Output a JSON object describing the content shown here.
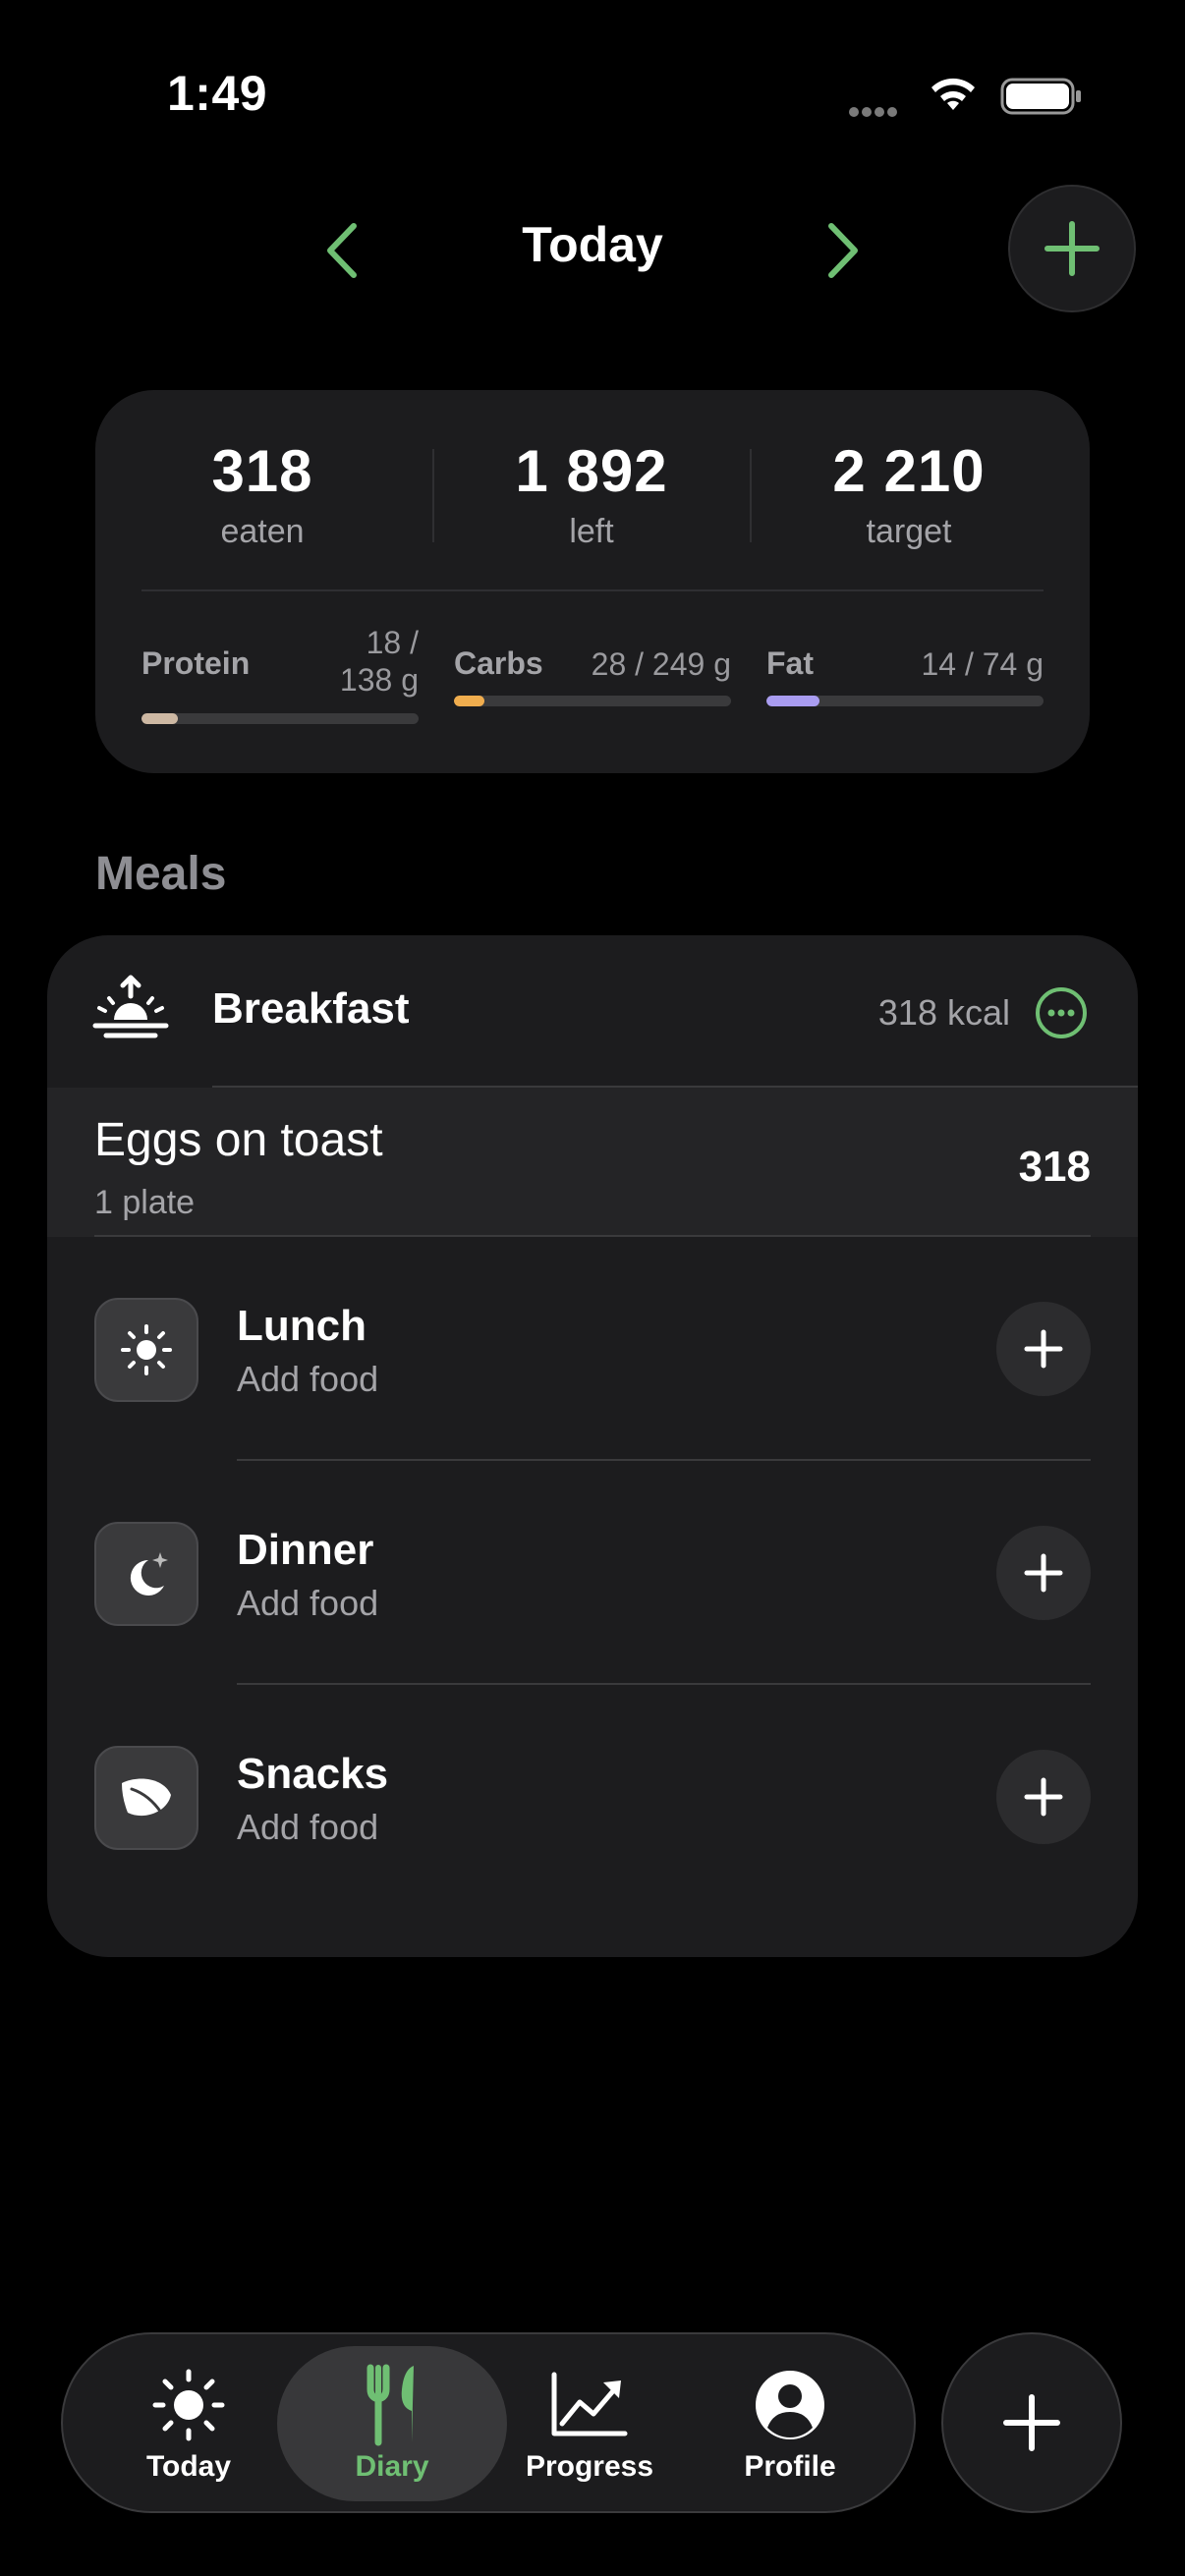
{
  "status_bar": {
    "time": "1:49"
  },
  "header": {
    "title": "Today"
  },
  "summary": {
    "eaten": {
      "value": "318",
      "label": "eaten"
    },
    "left": {
      "value": "1 892",
      "label": "left"
    },
    "target": {
      "value": "2 210",
      "label": "target"
    },
    "macros": [
      {
        "name": "Protein",
        "amount_line1": "18 /",
        "amount_line2": "138 g",
        "progress": 0.13,
        "color": "#cdb8a3"
      },
      {
        "name": "Carbs",
        "amount": "28 / 249 g",
        "progress": 0.11,
        "color": "#f0ad4e"
      },
      {
        "name": "Fat",
        "amount": "14 / 74 g",
        "progress": 0.19,
        "color": "#a99cf0"
      }
    ]
  },
  "meals_heading": "Meals",
  "meals": {
    "breakfast": {
      "title": "Breakfast",
      "kcal": "318 kcal",
      "entries": [
        {
          "name": "Eggs on toast",
          "qty": "1 plate",
          "kcal": "318"
        }
      ]
    },
    "lunch": {
      "title": "Lunch",
      "subtitle": "Add food",
      "icon": "sun-icon"
    },
    "dinner": {
      "title": "Dinner",
      "subtitle": "Add food",
      "icon": "moon-stars-icon"
    },
    "snacks": {
      "title": "Snacks",
      "subtitle": "Add food",
      "icon": "leaf-icon"
    }
  },
  "tabbar": {
    "tabs": [
      {
        "label": "Today",
        "icon": "sun-icon",
        "active": false
      },
      {
        "label": "Diary",
        "icon": "fork-knife-icon",
        "active": true
      },
      {
        "label": "Progress",
        "icon": "chart-trend-icon",
        "active": false
      },
      {
        "label": "Profile",
        "icon": "person-circle-icon",
        "active": false
      }
    ]
  },
  "colors": {
    "accent": "#6fbf73",
    "background": "#000000",
    "card": "#1c1c1e"
  }
}
